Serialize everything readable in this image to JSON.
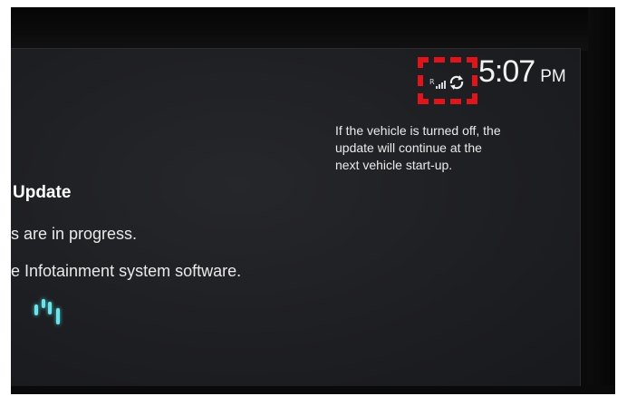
{
  "status_bar": {
    "time": "5:07",
    "ampm": "PM",
    "icons": [
      "signal-icon",
      "sync-icon"
    ],
    "highlight_color": "#e0141b"
  },
  "notice": {
    "lines": [
      "If the vehicle is turned off, the",
      "update will continue at the",
      "next vehicle start-up."
    ]
  },
  "main": {
    "title": "Update",
    "progress_text": "s are in progress.",
    "software_text": "e Infotainment system software."
  },
  "loader": {
    "color": "#6fe3e8"
  }
}
